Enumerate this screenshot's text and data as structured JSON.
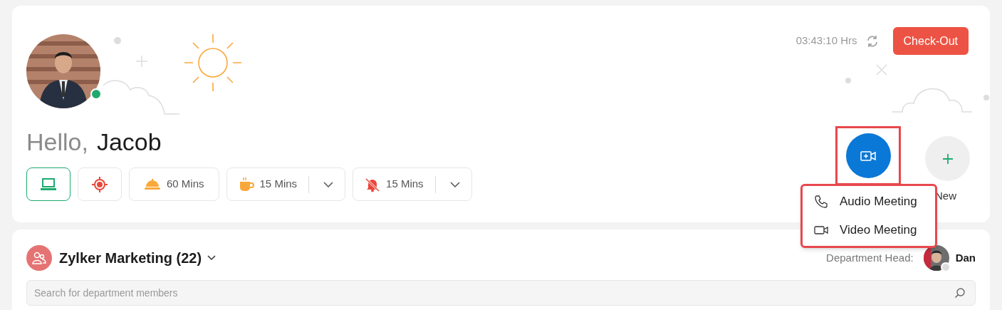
{
  "greeting": {
    "salutation": "Hello,",
    "name": "Jacob"
  },
  "user": {
    "online": true
  },
  "status_buttons": [
    {
      "kind": "icon",
      "selected": true
    },
    {
      "kind": "icon",
      "selected": false
    },
    {
      "kind": "timer",
      "label": "60 Mins",
      "selected": false
    },
    {
      "kind": "dropdown",
      "label": "15 Mins",
      "selected": false
    },
    {
      "kind": "dropdown",
      "label": "15 Mins",
      "selected": false
    }
  ],
  "timer": "03:43:10 Hrs",
  "check_out_button": "Check-Out",
  "meeting_button": {
    "highlighted": true
  },
  "new_button": {
    "label": "New"
  },
  "meeting_menu": {
    "highlighted": true,
    "items": [
      {
        "kind": "audio",
        "label": "Audio Meeting"
      },
      {
        "kind": "video",
        "label": "Video Meeting"
      }
    ]
  },
  "department": {
    "title": "Zylker Marketing (22)",
    "head_label": "Department Head:",
    "head_name": "Dan",
    "search_placeholder": "Search for department members"
  }
}
